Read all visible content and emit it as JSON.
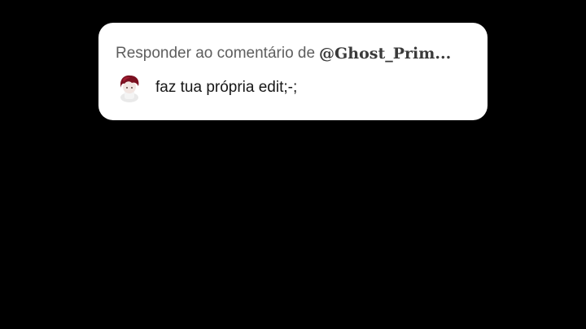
{
  "reply_card": {
    "header_prefix": "Responder ao comentário de",
    "handle": "@Ghost_Prim...",
    "comment_text": "faz tua própria edit;-;"
  },
  "icons": {
    "avatar": "user-avatar-icon"
  },
  "colors": {
    "background": "#000000",
    "card": "#ffffff",
    "header_text": "#5e5e5e",
    "comment_text": "#161616",
    "avatar_hair": "#7a1020"
  }
}
